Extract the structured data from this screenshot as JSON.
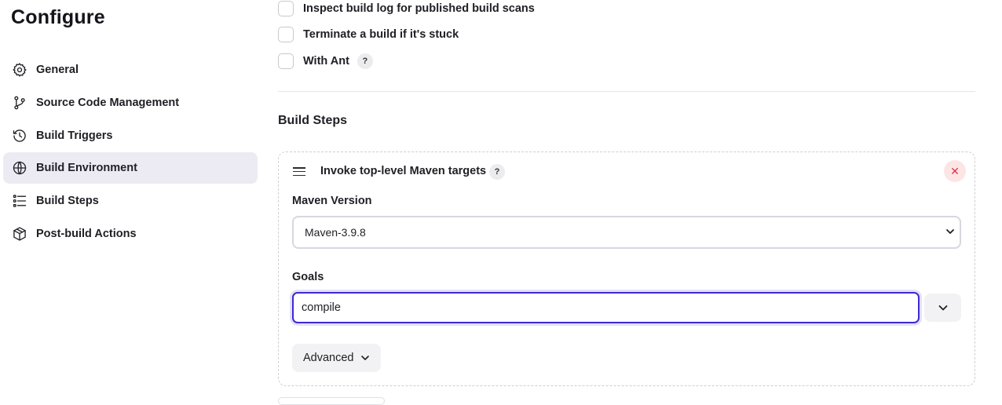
{
  "sidebar": {
    "title": "Configure",
    "items": [
      {
        "label": "General",
        "icon": "gear-icon",
        "active": false
      },
      {
        "label": "Source Code Management",
        "icon": "git-branch-icon",
        "active": false
      },
      {
        "label": "Build Triggers",
        "icon": "clock-icon",
        "active": false
      },
      {
        "label": "Build Environment",
        "icon": "globe-icon",
        "active": true
      },
      {
        "label": "Build Steps",
        "icon": "list-icon",
        "active": false
      },
      {
        "label": "Post-build Actions",
        "icon": "package-icon",
        "active": false
      }
    ]
  },
  "options": [
    {
      "label": "Inspect build log for published build scans",
      "checked": false,
      "help": false
    },
    {
      "label": "Terminate a build if it's stuck",
      "checked": false,
      "help": false
    },
    {
      "label": "With Ant",
      "checked": false,
      "help": true
    }
  ],
  "help_glyph": "?",
  "build_steps": {
    "heading": "Build Steps",
    "step": {
      "title": "Invoke top-level Maven targets",
      "remove_glyph": "✕",
      "maven_version_label": "Maven Version",
      "maven_version_value": "Maven-3.9.8",
      "goals_label": "Goals",
      "goals_value": "compile",
      "advanced_label": "Advanced"
    }
  },
  "colors": {
    "accent": "#3c2ad1",
    "active_nav": "#ecebf4",
    "remove": "#e0324a"
  }
}
